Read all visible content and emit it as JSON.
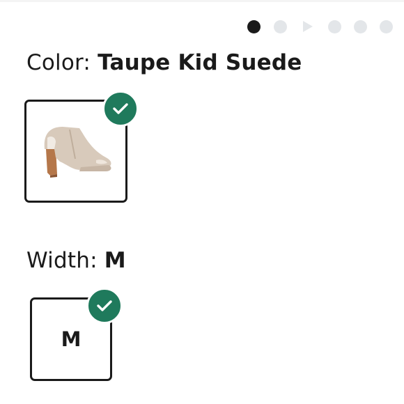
{
  "carousel": {
    "dots": [
      {
        "type": "dot",
        "active": true
      },
      {
        "type": "dot",
        "active": false
      },
      {
        "type": "play",
        "active": false
      },
      {
        "type": "dot",
        "active": false
      },
      {
        "type": "dot",
        "active": false
      },
      {
        "type": "dot",
        "active": false
      }
    ]
  },
  "color": {
    "label": "Color:",
    "value": "Taupe Kid Suede",
    "swatch_icon": "shoe-image",
    "selected": true
  },
  "width": {
    "label": "Width:",
    "value": "M",
    "options": [
      {
        "label": "M",
        "selected": true
      }
    ]
  },
  "colors": {
    "text": "#1a1a1a",
    "check_badge": "#1f7a5c",
    "dot_inactive": "#e3e6e9",
    "dot_active": "#1a1a1a"
  }
}
